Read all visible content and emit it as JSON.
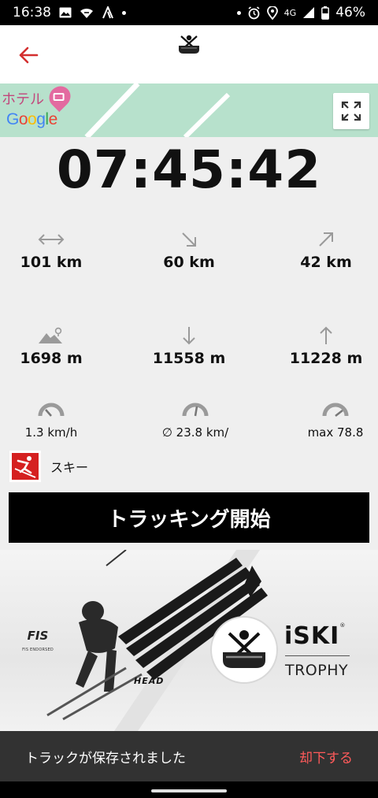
{
  "status_bar": {
    "time": "16:38",
    "network": "4G",
    "battery": "46%"
  },
  "app_bar": {
    "back_icon": "arrow-left-icon",
    "logo_icon": "iski-skull-logo-icon"
  },
  "map": {
    "poi_label": "ホテル",
    "attribution": "Google",
    "expand_icon": "fullscreen-icon"
  },
  "timer": {
    "value": "07:45:42"
  },
  "stats": {
    "distance": {
      "icon": "horizontal-arrows-icon",
      "value": "101 km"
    },
    "downhill_distance": {
      "icon": "arrow-down-right-icon",
      "value": "60 km"
    },
    "uphill_distance": {
      "icon": "arrow-up-right-icon",
      "value": "42 km"
    },
    "altitude": {
      "icon": "mountain-pin-icon",
      "value": "1698 m"
    },
    "descent": {
      "icon": "arrow-down-icon",
      "value": "11558 m"
    },
    "ascent": {
      "icon": "arrow-up-icon",
      "value": "11228 m"
    },
    "speed_current": {
      "icon": "speedometer-low-icon",
      "value": "1.3 km/h"
    },
    "speed_average": {
      "icon": "speedometer-mid-icon",
      "value": "∅ 23.8 km/"
    },
    "speed_max": {
      "icon": "speedometer-high-icon",
      "value": "max 78.8"
    }
  },
  "activity": {
    "icon": "skier-icon",
    "label": "スキー"
  },
  "tracking_button": {
    "label": "トラッキング開始"
  },
  "banner": {
    "fis_mark": "FIS",
    "fis_text": "FIS ENDORSED",
    "head_logo": "HEAD",
    "brand": "iSKI",
    "registered": "®",
    "product": "TROPHY"
  },
  "snackbar": {
    "message": "トラックが保存されました",
    "action": "却下する"
  },
  "colors": {
    "accent_red": "#d32f2f",
    "snackbar_action": "#ff5a5a",
    "map_green": "#b7e1cc"
  }
}
